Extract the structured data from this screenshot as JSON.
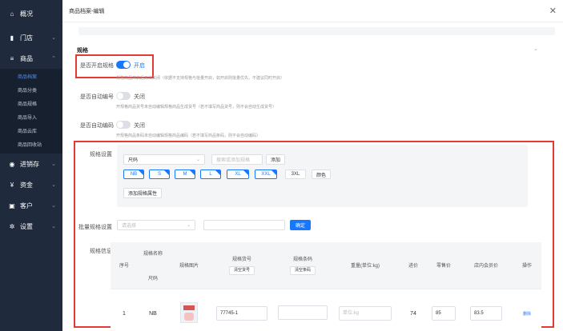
{
  "sidebar": {
    "items": [
      {
        "label": "概况",
        "icon": "home-icon"
      },
      {
        "label": "门店",
        "icon": "store-icon"
      },
      {
        "label": "商品",
        "icon": "list-icon"
      },
      {
        "label": "进销存",
        "icon": "inventory-icon"
      },
      {
        "label": "资金",
        "icon": "yuan-icon"
      },
      {
        "label": "客户",
        "icon": "card-icon"
      },
      {
        "label": "设置",
        "icon": "gear-icon"
      }
    ],
    "subitems": [
      "商品档案",
      "商品分类",
      "商品规格",
      "商品导入",
      "商品云库",
      "商品回收站"
    ]
  },
  "modal": {
    "title": "商品档案-编辑",
    "section_title": "规格",
    "rows": [
      {
        "label": "是否开启规格",
        "toggle_text": "开启",
        "on": true,
        "hint": "规格商品开启后无法关闭（依据不支持规格与批量开启，如开启则批量优先，不建议同时开启）"
      },
      {
        "label": "是否自动编号",
        "toggle_text": "关闭",
        "on": false,
        "hint": "开规格商品货号未自动编辑规格商品生成货号（若不填写商品货号，则不会自动生成货号）"
      },
      {
        "label": "是否自动编码",
        "toggle_text": "关闭",
        "on": false,
        "hint": "开规格商品条码未自动编辑规格商品编码（若不填写商品条码，则不会自动编码）"
      }
    ],
    "spec_settings_label": "规格设置",
    "spec_select": "尺码",
    "spec_search_placeholder": "搜索或添加规格",
    "spec_add": "添加",
    "sizes": [
      {
        "label": "NB",
        "selected": true
      },
      {
        "label": "S",
        "selected": true
      },
      {
        "label": "M",
        "selected": true
      },
      {
        "label": "L",
        "selected": true
      },
      {
        "label": "XL",
        "selected": true
      },
      {
        "label": "XXL",
        "selected": true
      },
      {
        "label": "3XL",
        "selected": false
      },
      {
        "label": "颜色",
        "selected": false
      }
    ],
    "add_attr": "添加规格属性",
    "batch_label": "批量规格设置",
    "batch_select_placeholder": "请选择",
    "batch_confirm": "确定",
    "spec_info_label": "规格信息",
    "table": {
      "headers": {
        "index": "序号",
        "spec_name": "规格名称",
        "spec_sub": "尺码",
        "image": "规格图片",
        "code": "规格货号",
        "code_btn": "清空货号",
        "barcode": "规格条码",
        "barcode_btn": "清空条码",
        "weight": "重量(单位:kg)",
        "cost": "进价",
        "retail": "零售价",
        "member": "店内会员价",
        "op": "操作"
      },
      "rows": [
        {
          "index": "1",
          "size": "NB",
          "code": "77745-1",
          "barcode": "",
          "weight_placeholder": "单位:kg",
          "cost": "74",
          "retail": "85",
          "member": "83.5",
          "op": "删除"
        }
      ]
    }
  }
}
